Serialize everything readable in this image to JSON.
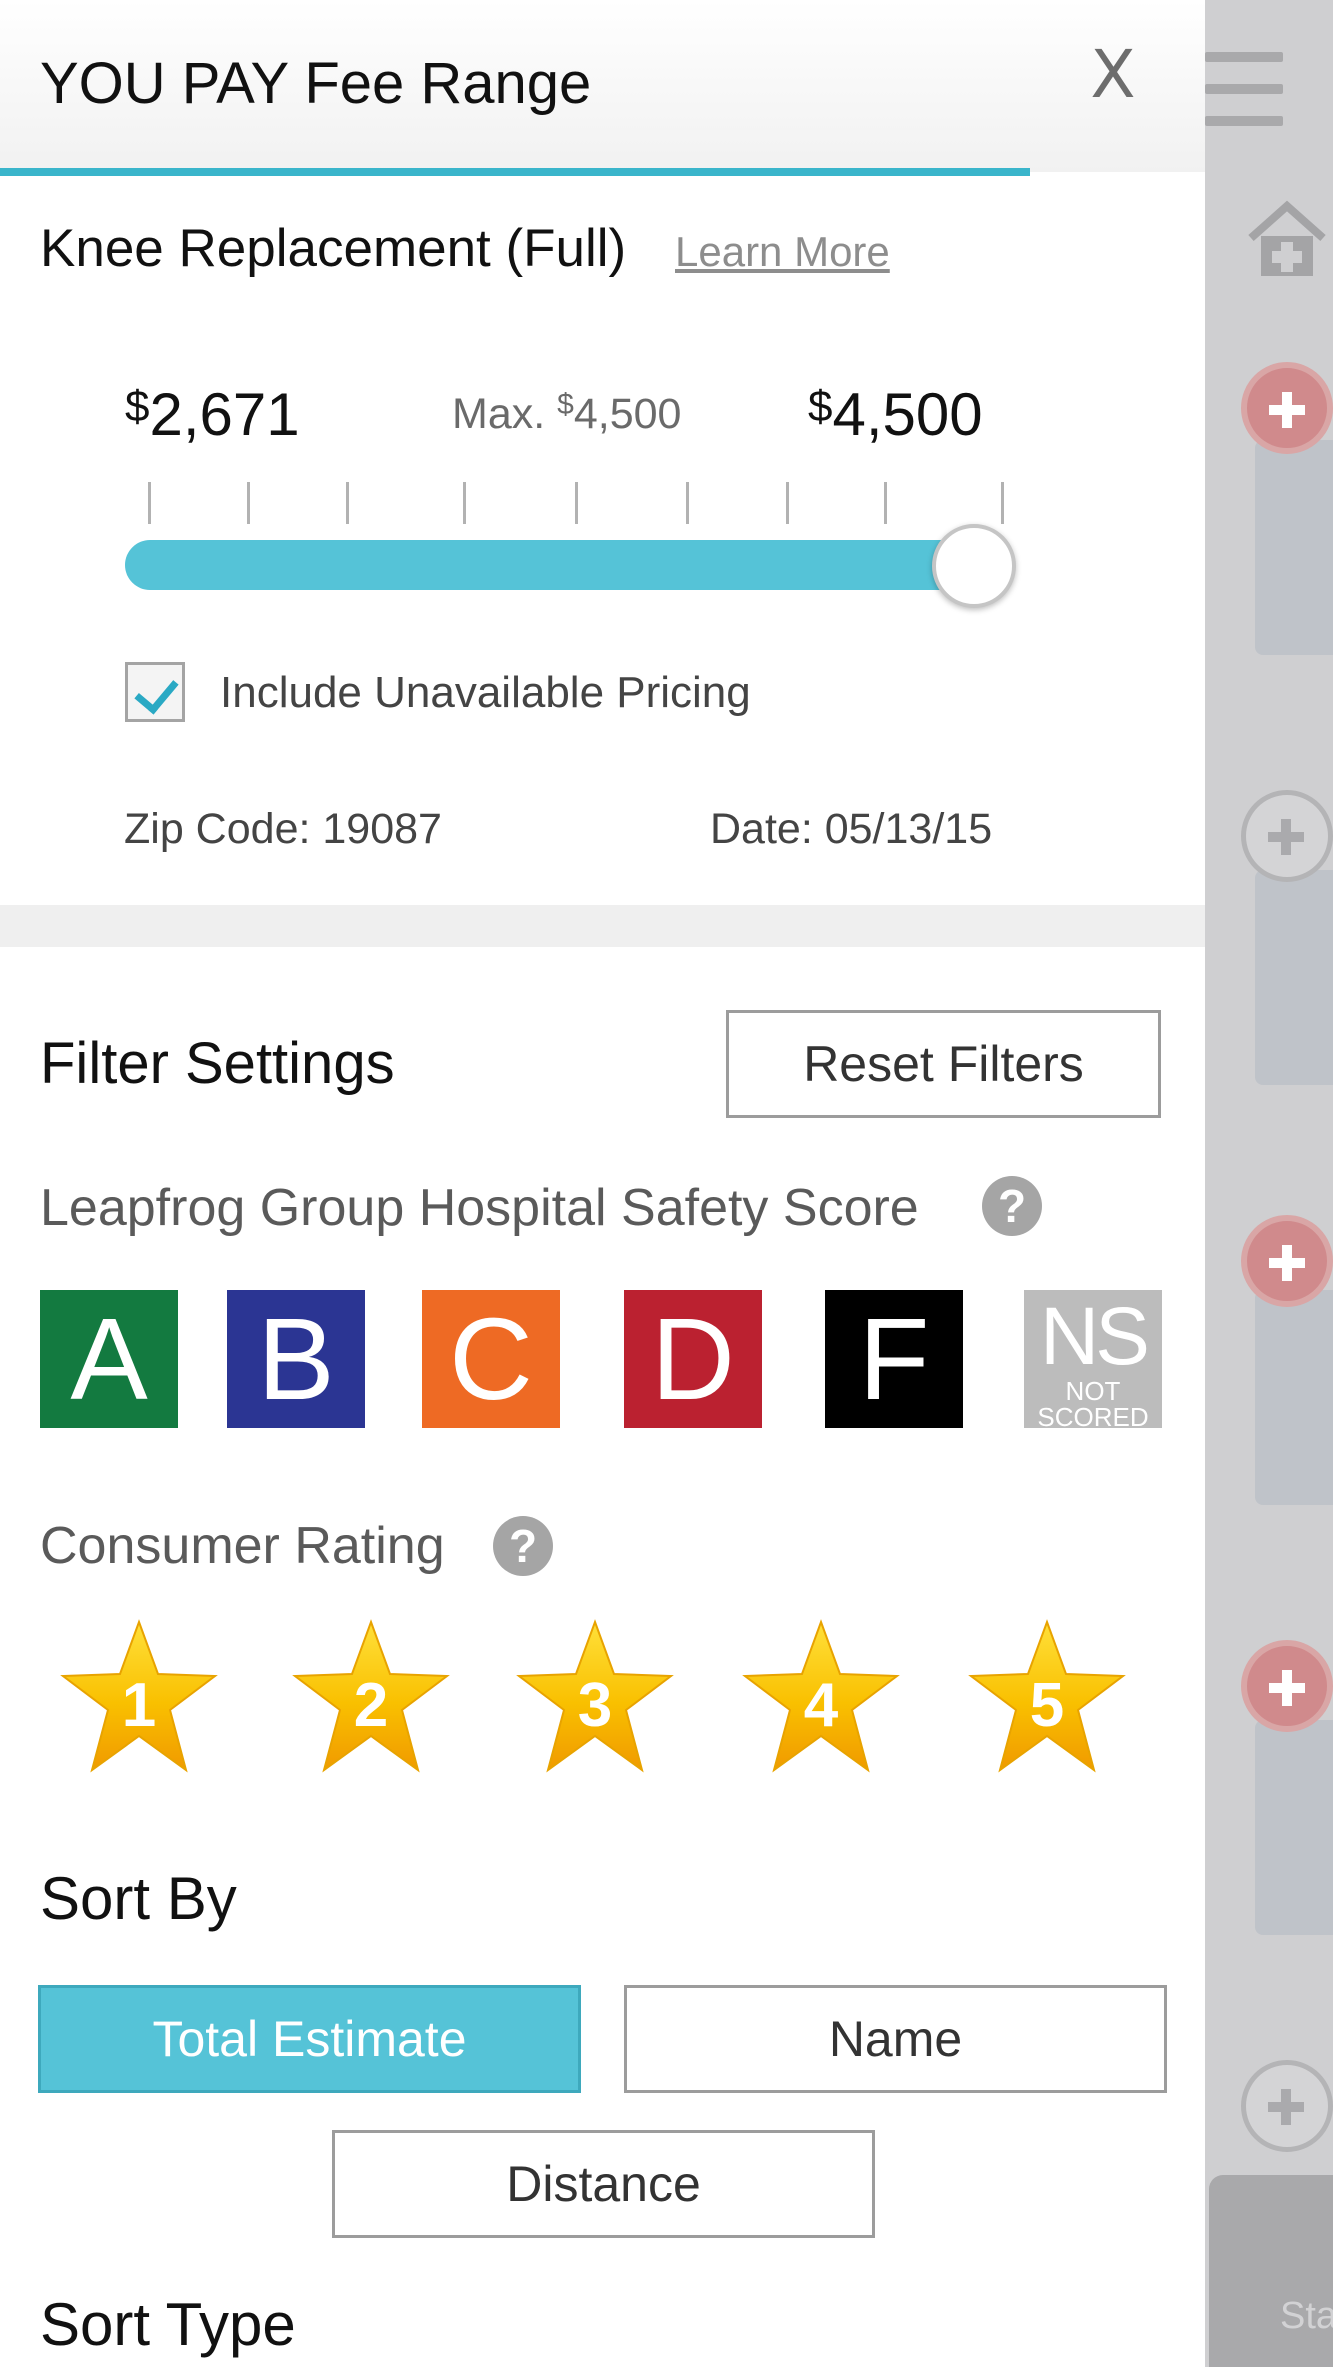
{
  "header": {
    "title": "YOU PAY Fee Range",
    "close_label": "X"
  },
  "procedure": {
    "name": "Knee Replacement (Full)",
    "learn_more": "Learn More"
  },
  "price_range": {
    "currency": "$",
    "min_value": "2,671",
    "max_value": "4,500",
    "max_prefix": "Max.",
    "max_limit": "4,500",
    "slider_fraction": 1.0
  },
  "include_unavailable": {
    "label": "Include Unavailable Pricing",
    "checked": true
  },
  "location": {
    "zip": "Zip Code: 19087",
    "date": "Date: 05/13/15"
  },
  "filters": {
    "title": "Filter Settings",
    "reset_label": "Reset Filters",
    "safety_label": "Leapfrog Group Hospital Safety Score",
    "grades": [
      {
        "letter": "A",
        "color": "#137a40"
      },
      {
        "letter": "B",
        "color": "#2b3593"
      },
      {
        "letter": "C",
        "color": "#ee6a24"
      },
      {
        "letter": "D",
        "color": "#bb2130"
      },
      {
        "letter": "F",
        "color": "#000000"
      },
      {
        "letter": "NS",
        "sub": "NOT SCORED",
        "color": "#bcbcbc"
      }
    ],
    "consumer_label": "Consumer Rating",
    "stars": [
      "1",
      "2",
      "3",
      "4",
      "5"
    ],
    "help_icon": "?"
  },
  "sort": {
    "title": "Sort By",
    "options": [
      "Total Estimate",
      "Name",
      "Distance"
    ],
    "active": "Total Estimate",
    "type_title": "Sort Type"
  },
  "background": {
    "tab_label": "Sta"
  },
  "colors": {
    "accent": "#55c3d7",
    "star_fill": "#f7b500"
  }
}
